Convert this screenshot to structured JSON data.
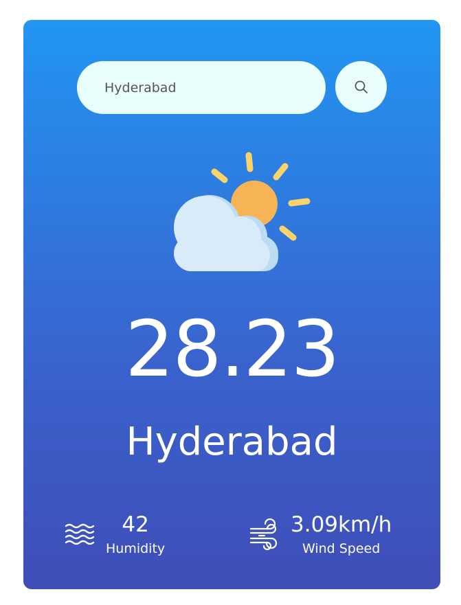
{
  "search": {
    "value": "Hyderabad",
    "icon": "search-icon"
  },
  "weather": {
    "icon": "partly-cloudy-icon",
    "temperature": "28.23",
    "city": "Hyderabad"
  },
  "stats": {
    "humidity": {
      "icon": "humidity-waves-icon",
      "value": "42",
      "label": "Humidity"
    },
    "wind": {
      "icon": "wind-icon",
      "value": "3.09km/h",
      "label": "Wind Speed"
    }
  },
  "colors": {
    "card_gradient_top": "#2196f3",
    "card_gradient_bottom": "#3f4db8",
    "search_background": "#e9fdfd",
    "sun": "#f7b455",
    "sun_rays": "#fbd36a",
    "cloud": "#d6eaf8"
  }
}
